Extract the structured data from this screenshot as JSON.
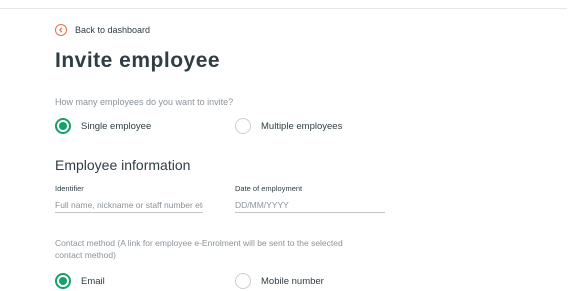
{
  "nav": {
    "back_label": "Back to dashboard"
  },
  "page": {
    "title": "Invite employee"
  },
  "invite_count": {
    "question": "How many employees do you want to invite?",
    "options": [
      {
        "label": "Single employee",
        "selected": true
      },
      {
        "label": "Multiple employees",
        "selected": false
      }
    ]
  },
  "employee_info": {
    "heading": "Employee information",
    "identifier": {
      "label": "Identifier",
      "placeholder": "Full name, nickname or staff number etc",
      "value": ""
    },
    "date_of_employment": {
      "label": "Date of employment",
      "placeholder": "DD/MM/YYYY",
      "value": ""
    }
  },
  "contact_method": {
    "label": "Contact method (A link for employee e-Enrolment will be sent to the selected contact method)",
    "options": [
      {
        "label": "Email",
        "selected": true
      },
      {
        "label": "Mobile number",
        "selected": false
      }
    ]
  },
  "colors": {
    "accent": "#16a06a",
    "back_icon": "#e8704b",
    "text": "#2f3d44",
    "muted": "#8b9399"
  }
}
